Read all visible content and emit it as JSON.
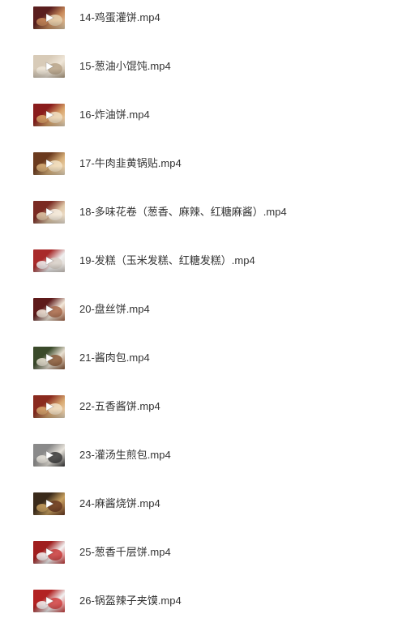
{
  "files": [
    {
      "name": "14-鸡蛋灌饼.mp4",
      "thumb_colors": [
        "#5a1e1e",
        "#c98a5a",
        "#e8d2b0"
      ],
      "play_icon": "play-icon"
    },
    {
      "name": "15-葱油小馄饨.mp4",
      "thumb_colors": [
        "#d8cbb8",
        "#efe6d8",
        "#b8a58a"
      ],
      "play_icon": "play-icon"
    },
    {
      "name": "16-炸油饼.mp4",
      "thumb_colors": [
        "#8a1c1c",
        "#d9a46a",
        "#f0dfc4"
      ],
      "play_icon": "play-icon"
    },
    {
      "name": "17-牛肉韭黄锅贴.mp4",
      "thumb_colors": [
        "#6b3a1e",
        "#d8b07a",
        "#f3e3c7"
      ],
      "play_icon": "play-icon"
    },
    {
      "name": "18-多味花卷（葱香、麻辣、红糖麻酱）.mp4",
      "thumb_colors": [
        "#7a2a22",
        "#e0c8a8",
        "#f6ede0"
      ],
      "play_icon": "play-icon"
    },
    {
      "name": "19-发糕（玉米发糕、红糖发糕）.mp4",
      "thumb_colors": [
        "#a82a2a",
        "#f0f0f0",
        "#d8d0c8"
      ],
      "play_icon": "play-icon"
    },
    {
      "name": "20-盘丝饼.mp4",
      "thumb_colors": [
        "#5e1a1a",
        "#f2e8da",
        "#a8684a"
      ],
      "play_icon": "play-icon"
    },
    {
      "name": "21-酱肉包.mp4",
      "thumb_colors": [
        "#3a4a2a",
        "#e8e0d2",
        "#8a5a3a"
      ],
      "play_icon": "play-icon"
    },
    {
      "name": "22-五香酱饼.mp4",
      "thumb_colors": [
        "#8a2a1e",
        "#d8a870",
        "#f2e2c8"
      ],
      "play_icon": "play-icon"
    },
    {
      "name": "23-灌汤生煎包.mp4",
      "thumb_colors": [
        "#8a8a8a",
        "#e8e4dc",
        "#3a3a3a"
      ],
      "play_icon": "play-icon"
    },
    {
      "name": "24-麻酱烧饼.mp4",
      "thumb_colors": [
        "#3a2a1a",
        "#c8a060",
        "#6a3a22"
      ],
      "play_icon": "play-icon"
    },
    {
      "name": "25-葱香千层饼.mp4",
      "thumb_colors": [
        "#a01e1e",
        "#f4f4f4",
        "#c83a3a"
      ],
      "play_icon": "play-icon"
    },
    {
      "name": "26-锅盔辣子夹馍.mp4",
      "thumb_colors": [
        "#b22222",
        "#f2f2f2",
        "#d04040"
      ],
      "play_icon": "play-icon"
    }
  ]
}
